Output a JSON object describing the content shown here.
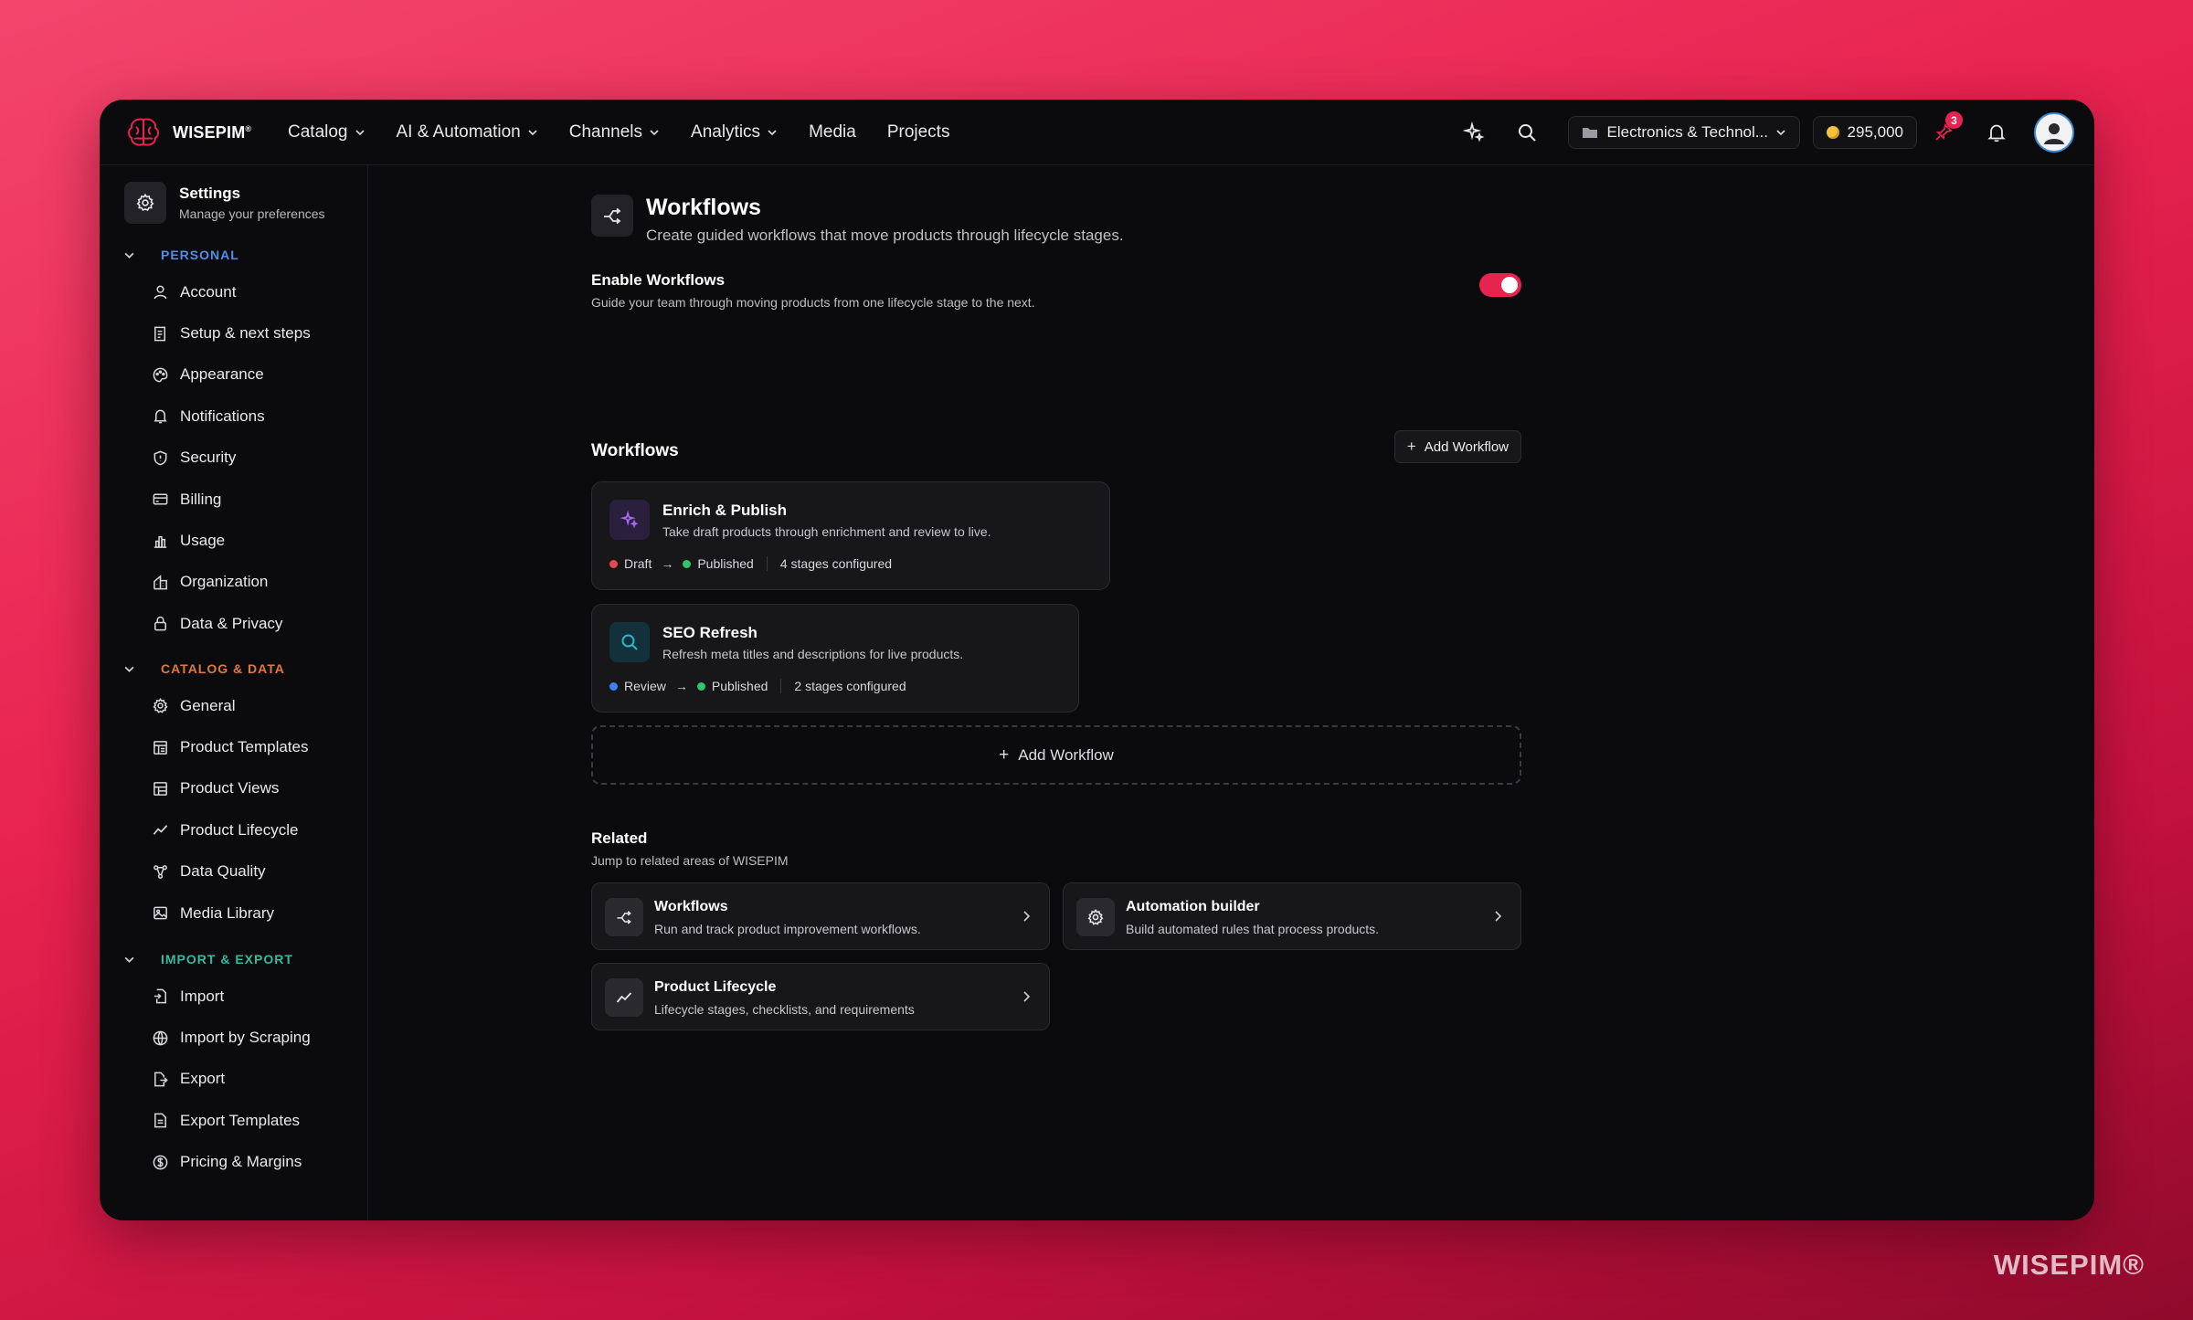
{
  "app": {
    "brand": "WISEPIM",
    "brand_mark": "®",
    "watermark": "WISEPIM®"
  },
  "nav": {
    "items": [
      {
        "label": "Catalog",
        "dropdown": true
      },
      {
        "label": "AI & Automation",
        "dropdown": true
      },
      {
        "label": "Channels",
        "dropdown": true
      },
      {
        "label": "Analytics",
        "dropdown": true
      },
      {
        "label": "Media",
        "dropdown": false
      },
      {
        "label": "Projects",
        "dropdown": false
      }
    ],
    "store_selector": "Electronics & Technol...",
    "credits": "295,000",
    "alerts_badge": "3"
  },
  "sidebar": {
    "title": "Settings",
    "subtitle": "Manage your preferences",
    "sections": [
      {
        "label": "PERSONAL",
        "color": "#4f8fe6",
        "items": [
          "Account",
          "Setup & next steps",
          "Appearance",
          "Notifications",
          "Security",
          "Billing",
          "Usage",
          "Organization",
          "Data & Privacy"
        ]
      },
      {
        "label": "CATALOG & DATA",
        "color": "#e07a3c",
        "items": [
          "General",
          "Product Templates",
          "Product Views",
          "Product Lifecycle",
          "Data Quality",
          "Media Library"
        ]
      },
      {
        "label": "IMPORT & EXPORT",
        "color": "#39b7a0",
        "items": [
          "Import",
          "Import by Scraping",
          "Export",
          "Export Templates",
          "Pricing & Margins"
        ]
      }
    ]
  },
  "page": {
    "title": "Workflows",
    "subtitle": "Create guided workflows that move products through lifecycle stages.",
    "toggle": {
      "title": "Enable Workflows",
      "subtitle": "Guide your team through moving products from one lifecycle stage to the next.",
      "enabled": true
    },
    "workflows_heading": "Workflows",
    "add_button": "Add Workflow",
    "workflows": [
      {
        "name": "Enrich & Publish",
        "description": "Take draft products through enrichment and review to live.",
        "from": "Draft",
        "from_color": "#e5484d",
        "to": "Published",
        "to_color": "#30c46b",
        "stages": "4 stages configured",
        "icon": "sparkles-icon"
      },
      {
        "name": "SEO Refresh",
        "description": "Refresh meta titles and descriptions for live products.",
        "from": "Review",
        "from_color": "#3b82f6",
        "to": "Published",
        "to_color": "#30c46b",
        "stages": "2 stages configured",
        "icon": "search-icon"
      }
    ],
    "add_dashed": "Add Workflow",
    "related": {
      "title": "Related",
      "subtitle": "Jump to related areas of WISEPIM",
      "cards": [
        {
          "title": "Workflows",
          "description": "Run and track product improvement workflows."
        },
        {
          "title": "Automation builder",
          "description": "Build automated rules that process products."
        },
        {
          "title": "Product Lifecycle",
          "description": "Lifecycle stages, checklists, and requirements"
        }
      ]
    }
  }
}
